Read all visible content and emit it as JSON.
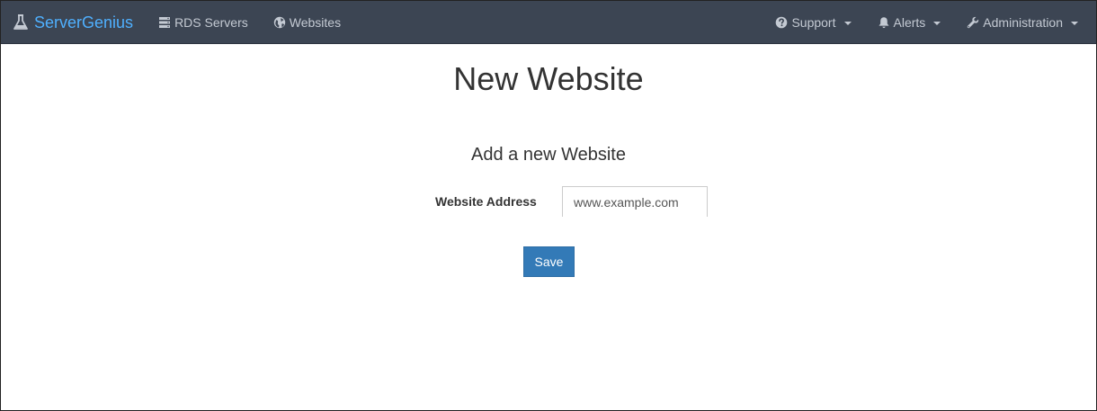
{
  "navbar": {
    "brand": {
      "label": "ServerGenius",
      "icon": "flask-icon"
    },
    "left_links": [
      {
        "label": "RDS Servers",
        "icon": "server-icon"
      },
      {
        "label": "Websites",
        "icon": "globe-icon"
      }
    ],
    "right_links": [
      {
        "label": "Support",
        "icon": "question-circle-icon",
        "dropdown": true
      },
      {
        "label": "Alerts",
        "icon": "bell-icon",
        "dropdown": true
      },
      {
        "label": "Administration",
        "icon": "wrench-icon",
        "dropdown": true
      }
    ],
    "colors": {
      "background": "#3c4553",
      "brand": "#4fb0ff",
      "link": "#c4cad3"
    }
  },
  "page": {
    "title": "New Website"
  },
  "form": {
    "title": "Add a new Website",
    "website_address": {
      "label": "Website Address",
      "placeholder": "www.example.com",
      "value": ""
    },
    "save_label": "Save",
    "save_color": "#337ab7"
  }
}
